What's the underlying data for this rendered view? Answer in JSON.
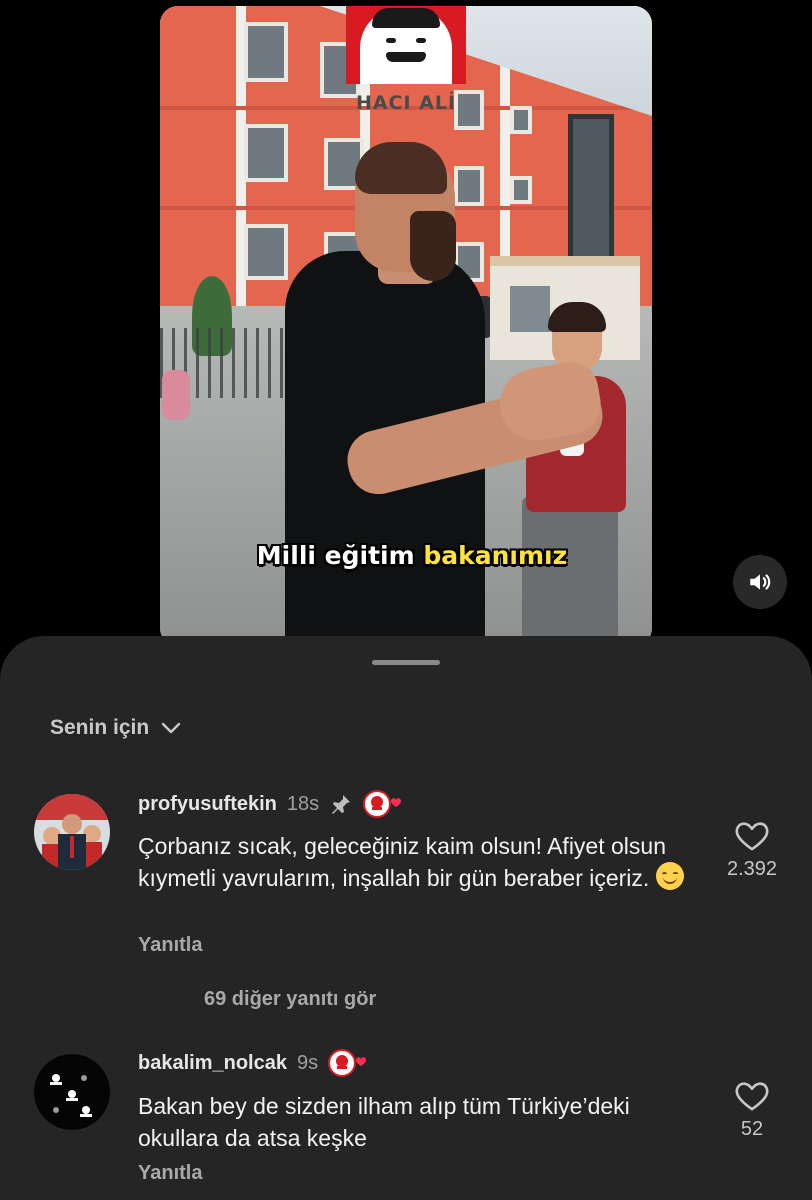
{
  "video": {
    "brand_text": "HACI ALİ",
    "caption_white": "Milli eğitim",
    "caption_highlight": "bakanımız",
    "sound_icon": "speaker-volume-icon"
  },
  "sheet": {
    "sort_label": "Senin için",
    "sort_icon": "chevron-down-icon"
  },
  "comments": [
    {
      "username": "profyusuftekin",
      "time": "18s",
      "pinned_icon": "pin-icon",
      "creator_liked_icon": "creator-heart-badge-icon",
      "text": "Çorbanız sıcak, geleceğiniz kaim olsun! Afiyet olsun kıymetli yavrularım, inşallah bir gün beraber içeriz.",
      "reply_label": "Yanıtla",
      "like_count": "2.392",
      "view_replies": "69 diğer yanıtı gör"
    },
    {
      "username": "bakalim_nolcak",
      "time": "9s",
      "creator_liked_icon": "creator-heart-badge-icon",
      "text": "Bakan bey de sizden ilham alıp tüm Türkiye’deki okullara da atsa keşke",
      "reply_label": "Yanıtla",
      "like_count": "52"
    }
  ],
  "colors": {
    "background": "#000000",
    "sheet": "#252525",
    "brand_red": "#d81b23",
    "caption_highlight": "#ffe33b"
  }
}
